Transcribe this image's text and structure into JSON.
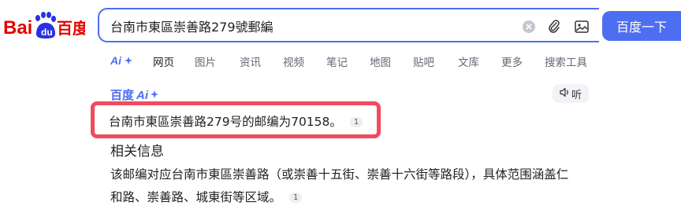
{
  "brand": {
    "logo_text_left": "Bai",
    "logo_text_right": "百度",
    "colors": {
      "red": "#e10601",
      "blue": "#2932e1",
      "accent": "#4e6ef2",
      "highlight": "#f24a5e"
    }
  },
  "search": {
    "query": "台南市東區崇善路279號郵編",
    "button_label": "百度一下",
    "icons": [
      "clear-icon",
      "paperclip-icon",
      "image-search-icon"
    ]
  },
  "tabs": [
    {
      "label": "网页",
      "active": true
    },
    {
      "label": "图片"
    },
    {
      "label": "资讯"
    },
    {
      "label": "视频"
    },
    {
      "label": "笔记"
    },
    {
      "label": "地图"
    },
    {
      "label": "贴吧"
    },
    {
      "label": "文库"
    },
    {
      "label": "更多"
    },
    {
      "label": "搜索工具"
    }
  ],
  "ai": {
    "tab_label": "Ai",
    "logo_text": "百度",
    "logo_suffix": "Ai",
    "listen_label": "听",
    "answer": "台南市東區崇善路279号的邮编为70158。",
    "answer_citation": "1",
    "section_heading": "相关信息",
    "detail_line1": "该邮编对应台南市東區崇善路（或崇善十五街、崇善十六街等路段），具体范围涵盖仁",
    "detail_line2": "和路、崇善路、城東街等区域。",
    "detail_citation": "1"
  }
}
